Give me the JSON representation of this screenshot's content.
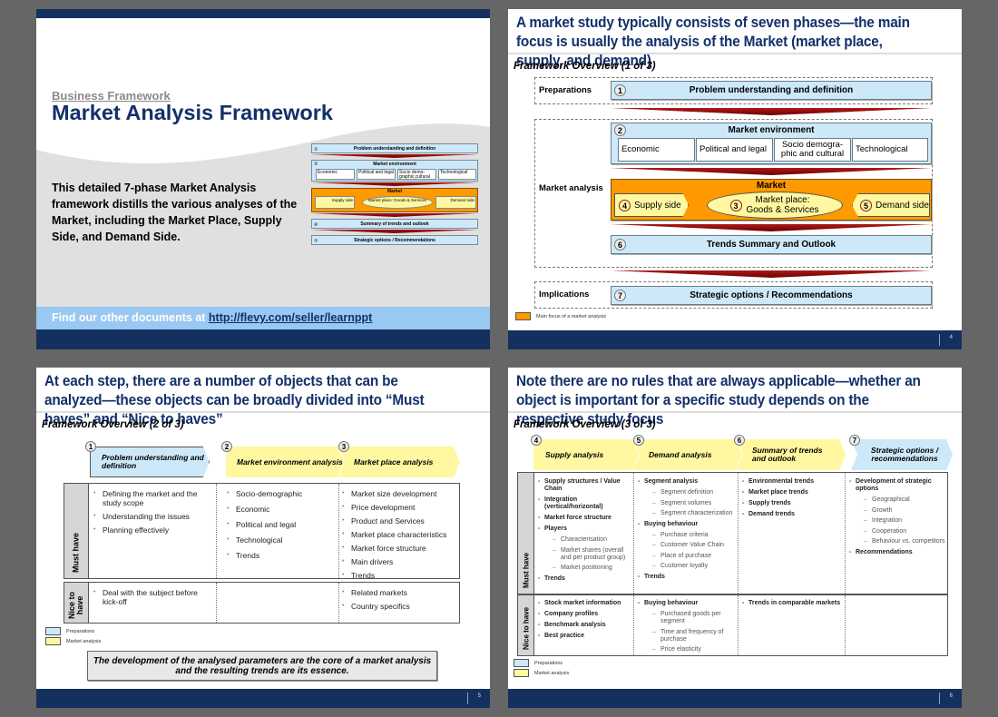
{
  "slide1": {
    "category": "Business Framework",
    "title": "Market Analysis Framework",
    "description": "This detailed 7-phase Market Analysis framework distills the various analyses of the Market, including the Market Place, Supply Side, and Demand Side.",
    "link_prefix": "Find our other documents at ",
    "link_text": "http://flevy.com/seller/learnppt",
    "mini": {
      "p1": "Problem understanding and definition",
      "p2": "Market environment",
      "env": [
        "Economic",
        "Political and legal",
        "Socio demo-graphic,cultural",
        "Technological"
      ],
      "market": "Market",
      "supply": "Supply side",
      "place": "Market place: Goods & Services",
      "demand": "Demand side",
      "p6": "Summary of trends and outlook",
      "p7": "Strategic options / Recommendations",
      "n": [
        "①",
        "②",
        "③",
        "④",
        "⑤",
        "⑥",
        "⑦"
      ]
    }
  },
  "slide2": {
    "headline": "A market study typically consists of seven phases—the main focus is usually the analysis of the Market (market place, supply, and demand)",
    "subtitle": "Framework Overview (1 of 3)",
    "rows": {
      "preparations": "Preparations",
      "market_analysis": "Market analysis",
      "implications": "Implications"
    },
    "phase1": {
      "num": "1",
      "label": "Problem understanding and definition"
    },
    "phase2": {
      "num": "2",
      "label": "Market environment",
      "items": [
        "Economic",
        "Political and legal",
        "Socio demogra-phic and cultural",
        "Technological"
      ]
    },
    "market": {
      "label": "Market",
      "supply_num": "4",
      "supply": "Supply side",
      "place_num": "3",
      "place": "Market place: Goods & Services",
      "demand_num": "5",
      "demand": "Demand side"
    },
    "phase6": {
      "num": "6",
      "label": "Trends Summary and Outlook"
    },
    "phase7": {
      "num": "7",
      "label": "Strategic options / Recommendations"
    },
    "legend": "Main focus of a market analysis",
    "page": "4",
    "colors": {
      "focus": "#ff9900",
      "box": "#cde9f9",
      "navy": "#13305f"
    }
  },
  "slide3": {
    "headline": "At each step, there are a number of objects that can be analyzed—these objects can be broadly divided into “Must haves” and “Nice to haves”",
    "subtitle": "Framework Overview (2 of 3)",
    "phases": [
      {
        "num": "1",
        "label": "Problem understanding and definition"
      },
      {
        "num": "2",
        "label": "Market environment analysis"
      },
      {
        "num": "3",
        "label": "Market place analysis"
      }
    ],
    "must_have_label": "Must have",
    "nice_label": "Nice to have",
    "must_have": [
      [
        "Defining the market and the study scope",
        "Understanding the issues",
        "Planning effectively"
      ],
      [
        "Socio-demographic",
        "Economic",
        "Political and legal",
        "Technological",
        "Trends"
      ],
      [
        "Market size development",
        "Price development",
        "Product and Services",
        "Market place characteristics",
        "Market force structure",
        "Main drivers",
        "Trends"
      ]
    ],
    "nice_to_have": [
      [
        "Deal with the subject before kick-off"
      ],
      [],
      [
        "Related markets",
        "Country specifics"
      ]
    ],
    "legend": [
      "Preparations",
      "Market analysis"
    ],
    "note": "The development of the analysed parameters are the core of a market analysis and the resulting trends are its essence.",
    "page": "5"
  },
  "slide4": {
    "headline": "Note there are no rules that are always applicable—whether an object is important for a specific study depends on the respective study focus",
    "subtitle": "Framework Overview (3 of 3)",
    "phases": [
      {
        "num": "4",
        "label": "Supply analysis"
      },
      {
        "num": "5",
        "label": "Demand analysis"
      },
      {
        "num": "6",
        "label": "Summary of trends and outlook"
      },
      {
        "num": "7",
        "label": "Strategic options / recommendations"
      }
    ],
    "must_have_label": "Must have",
    "nice_label": "Nice to have",
    "must_have": [
      [
        {
          "t": "Supply structures / Value Chain",
          "lvl": 1
        },
        {
          "t": "Integration (vertical/horizontal)",
          "lvl": 1
        },
        {
          "t": "Market force structure",
          "lvl": 1
        },
        {
          "t": "Players",
          "lvl": 1
        },
        {
          "t": "Characterisation",
          "lvl": 2
        },
        {
          "t": "Market shares (overall and per product group)",
          "lvl": 2
        },
        {
          "t": "Market positioning",
          "lvl": 2
        },
        {
          "t": "Trends",
          "lvl": 1
        }
      ],
      [
        {
          "t": "Segment analysis",
          "lvl": 1
        },
        {
          "t": "Segment definition",
          "lvl": 2
        },
        {
          "t": "Segment volumes",
          "lvl": 2
        },
        {
          "t": "Segment characterization",
          "lvl": 2
        },
        {
          "t": "Buying behaviour",
          "lvl": 1
        },
        {
          "t": "Purchase criteria",
          "lvl": 2
        },
        {
          "t": "Customer Value Chain",
          "lvl": 2
        },
        {
          "t": "Place of purchase",
          "lvl": 2
        },
        {
          "t": "Customer loyalty",
          "lvl": 2
        },
        {
          "t": "Trends",
          "lvl": 1
        }
      ],
      [
        {
          "t": "Environmental trends",
          "lvl": 1
        },
        {
          "t": "Market place trends",
          "lvl": 1
        },
        {
          "t": "Supply trends",
          "lvl": 1
        },
        {
          "t": "Demand trends",
          "lvl": 1
        }
      ],
      [
        {
          "t": "Development of strategic options",
          "lvl": 1
        },
        {
          "t": "Geographical",
          "lvl": 2
        },
        {
          "t": "Growth",
          "lvl": 2
        },
        {
          "t": "Integration",
          "lvl": 2
        },
        {
          "t": "Cooperation",
          "lvl": 2
        },
        {
          "t": "Behaviour vs. competitors",
          "lvl": 2
        },
        {
          "t": "Recommendations",
          "lvl": 1
        }
      ]
    ],
    "nice_to_have": [
      [
        {
          "t": "Stock market information",
          "lvl": 1
        },
        {
          "t": "Company profiles",
          "lvl": 1
        },
        {
          "t": "Benchmark analysis",
          "lvl": 1
        },
        {
          "t": "Best practice",
          "lvl": 1
        }
      ],
      [
        {
          "t": "Buying behaviour",
          "lvl": 1
        },
        {
          "t": "Purchased goods per segment",
          "lvl": 2
        },
        {
          "t": "Time and frequency of purchase",
          "lvl": 2
        },
        {
          "t": "Price elasticity",
          "lvl": 2
        }
      ],
      [
        {
          "t": "Trends in comparable markets",
          "lvl": 1
        }
      ],
      []
    ],
    "legend": [
      "Preparations",
      "Market analysis"
    ],
    "page": "6"
  }
}
